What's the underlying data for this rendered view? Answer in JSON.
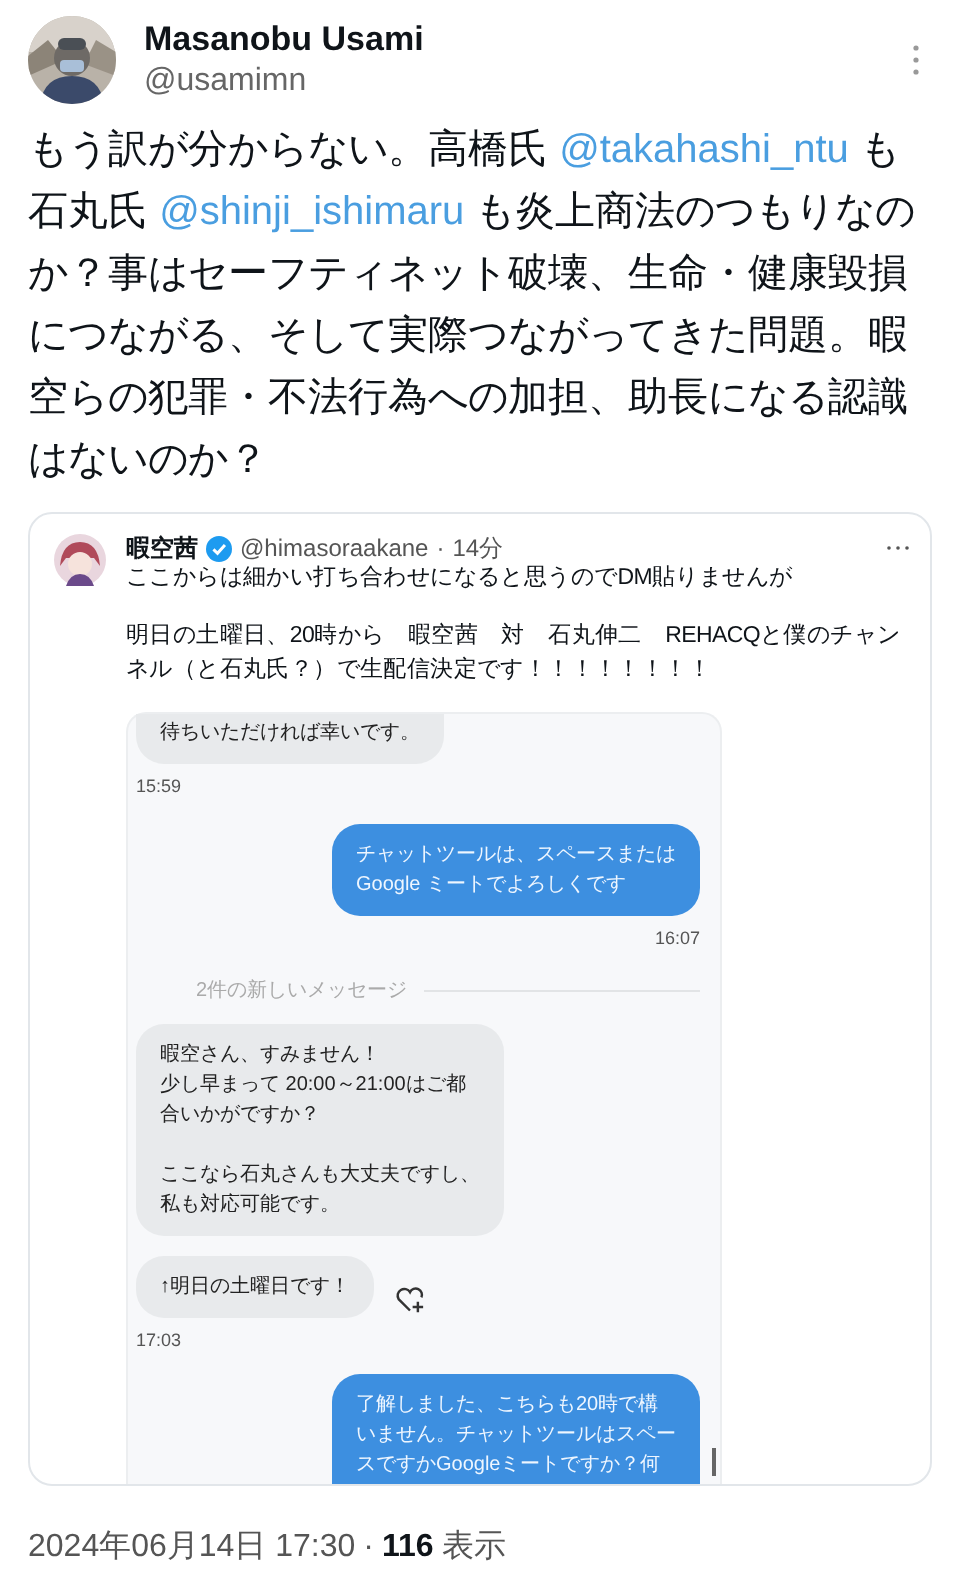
{
  "tweet": {
    "author": {
      "name": "Masanobu Usami",
      "handle": "@usamimn"
    },
    "text": [
      {
        "kind": "text",
        "text": "もう訳が分からない。高橋氏 "
      },
      {
        "kind": "mention",
        "text": "@takahashi_ntu"
      },
      {
        "kind": "text",
        "text": " も石丸氏 "
      },
      {
        "kind": "mention",
        "text": "@shinji_ishimaru"
      },
      {
        "kind": "text",
        "text": " も炎上商法のつもりなのか？事はセーフティネット破壊、生命・健康毀損につながる、そして実際つながってきた問題。暇空らの犯罪・不法行為への加担、助長になる認識はないのか？"
      }
    ],
    "quote": {
      "name": "暇空茜",
      "verified": true,
      "handle": "@himasoraakane",
      "separator": "·",
      "time": "14分",
      "paragraphs": [
        "ここからは細かい打ち合わせになると思うのでDM貼りませんが",
        "明日の土曜日、20時から　暇空茜　対　石丸伸二　REHACQと僕のチャンネル（と石丸氏？）で生配信決定です！！！！！！！！"
      ],
      "messages": [
        {
          "kind": "received",
          "paragraphs": [
            [
              "待ちいただければ幸いです。"
            ]
          ],
          "react": false,
          "time": "15:59"
        },
        {
          "kind": "sent",
          "paragraphs": [
            [
              "チャットツールは、スペースまたは",
              "Google ミートでよろしくです"
            ]
          ],
          "react": false,
          "time": "16:07"
        },
        {
          "kind": "divider",
          "text": "2件の新しいメッセージ"
        },
        {
          "kind": "received",
          "paragraphs": [
            [
              "暇空さん、すみません！",
              "少し早まって 20:00～21:00はご都",
              "合いかがですか？"
            ],
            [
              "ここなら石丸さんも大丈夫ですし、",
              "私も対応可能です。"
            ]
          ],
          "react": false
        },
        {
          "kind": "received",
          "paragraphs": [
            [
              "↑明日の土曜日です！"
            ]
          ],
          "react": true,
          "time": "17:03"
        },
        {
          "kind": "sent",
          "paragraphs": [
            [
              "了解しました、こちらも20時で構",
              "いません。チャットツールはスペー",
              "スですかGoogleミートですか？何"
            ]
          ],
          "react": false
        }
      ]
    },
    "timestamp": "2024年06月14日 17:30",
    "dot": "·",
    "views": "116",
    "views_label": "表示"
  }
}
